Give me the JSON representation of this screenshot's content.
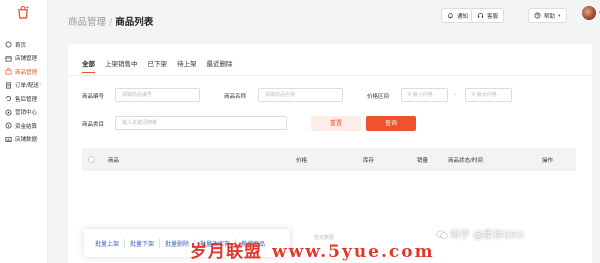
{
  "sidebar": {
    "items": [
      {
        "label": "首页",
        "icon": "home-icon",
        "active": false
      },
      {
        "label": "店铺管理",
        "icon": "store-icon",
        "active": false
      },
      {
        "label": "商品管理",
        "icon": "goods-icon",
        "active": true
      },
      {
        "label": "订单/配送",
        "icon": "order-icon",
        "active": false,
        "suffix": "›"
      },
      {
        "label": "售后管理",
        "icon": "after-sales-icon",
        "active": false
      },
      {
        "label": "营销中心",
        "icon": "marketing-icon",
        "active": false
      },
      {
        "label": "资金结算",
        "icon": "settlement-icon",
        "active": false
      },
      {
        "label": "店铺数据",
        "icon": "data-icon",
        "active": false
      }
    ]
  },
  "header": {
    "breadcrumb_parent": "商品管理",
    "breadcrumb_sep": "/",
    "breadcrumb_current": "商品列表",
    "notify_label": "通知",
    "service_label": "客服",
    "help_label": "帮助",
    "help_caret": "▾",
    "avatar_caret": "▾"
  },
  "tabs": [
    "全部",
    "上架销售中",
    "已下架",
    "待上架",
    "最近删除"
  ],
  "filters": {
    "code_label": "商品编号",
    "code_placeholder": "请输商品编号",
    "name_label": "商品名称",
    "name_placeholder": "请输商品名称",
    "price_label": "价格区间",
    "price_min_placeholder": "¥ 最小价格",
    "price_sep": "-",
    "price_max_placeholder": "¥ 最大价格",
    "category_label": "商品类目",
    "category_placeholder": "输入关键词搜索",
    "reset_label": "重置",
    "query_label": "查询"
  },
  "table": {
    "columns": [
      "商品",
      "价格",
      "库存",
      "销量",
      "商品状态/时间",
      "操作"
    ],
    "empty_text": "暂无数据"
  },
  "bulk_actions": [
    "批量上架",
    "批量下架",
    "批量删除",
    "批量改库存",
    "新增商品"
  ],
  "watermarks": {
    "zhihu": "知乎 @臣徐SEO",
    "site_name": "岁月联盟",
    "site_domain": "www.5yue.com"
  },
  "colors": {
    "accent": "#f0522b",
    "link": "#3a5fbf",
    "watermark": "#e0392b"
  }
}
